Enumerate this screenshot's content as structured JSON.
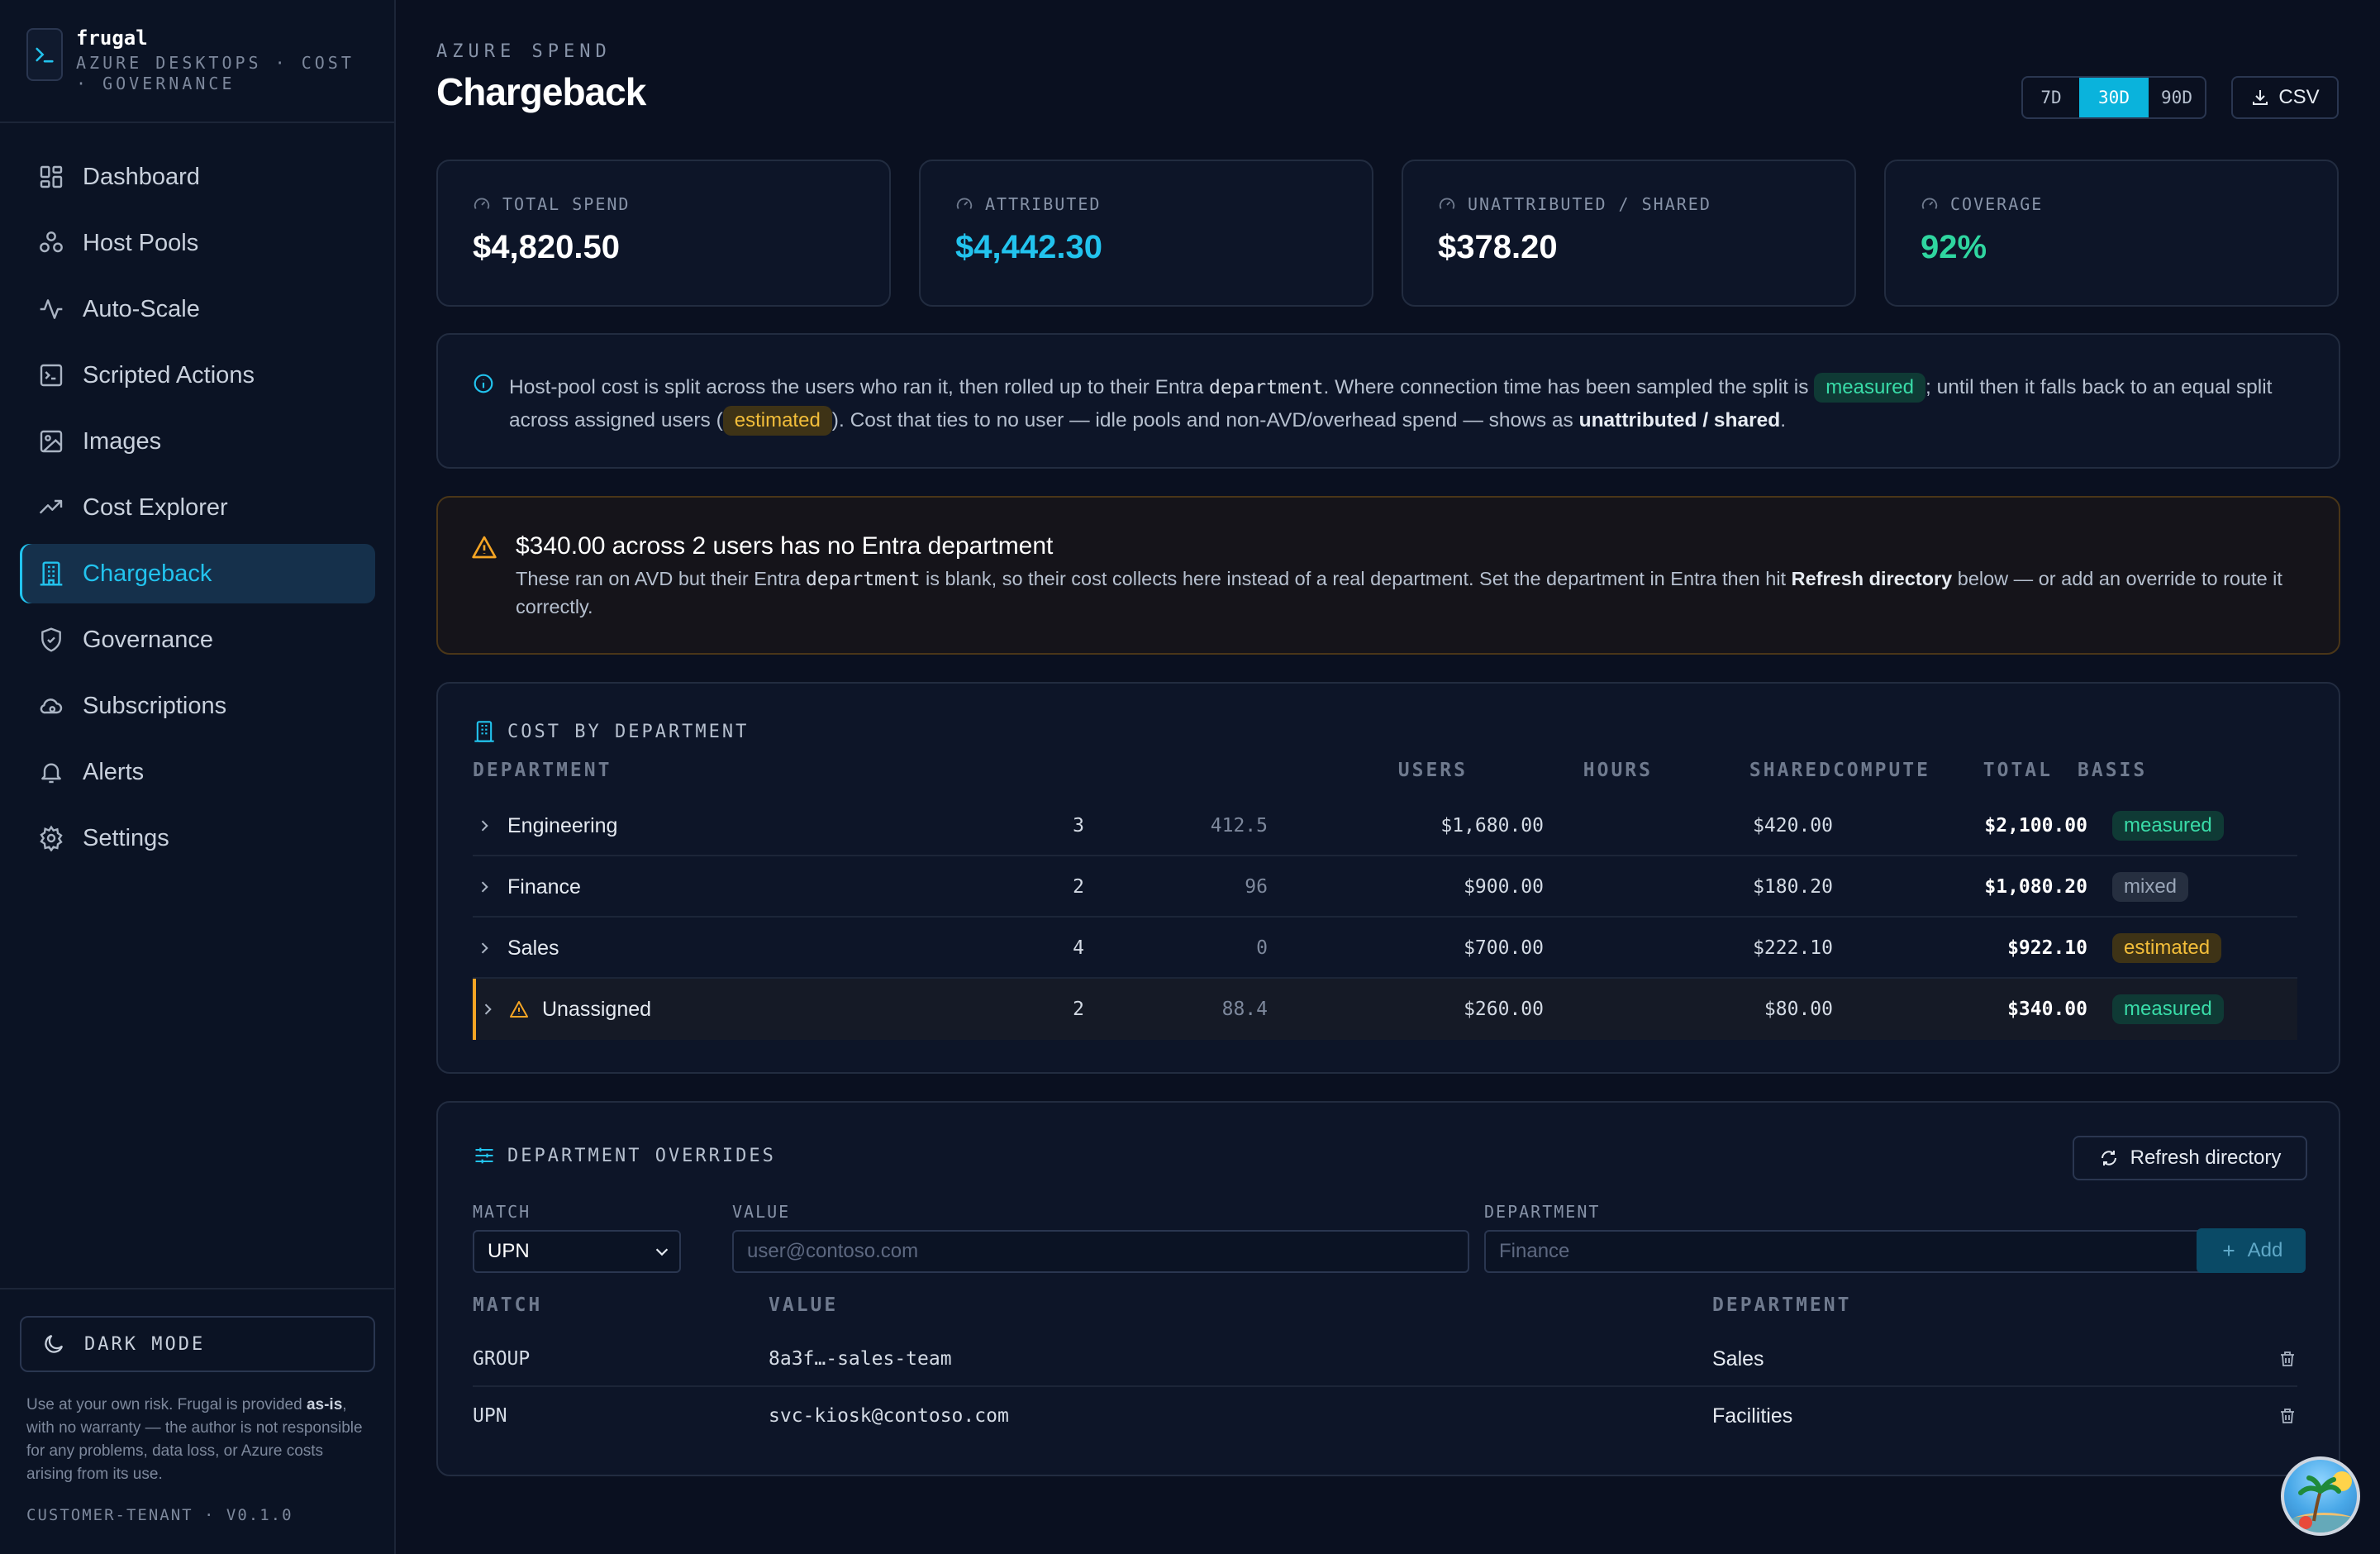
{
  "brand": {
    "name": "frugal",
    "subtitle": "AZURE DESKTOPS · COST · GOVERNANCE"
  },
  "nav": [
    {
      "label": "Dashboard",
      "icon": "dashboard-icon"
    },
    {
      "label": "Host Pools",
      "icon": "host-pools-icon"
    },
    {
      "label": "Auto-Scale",
      "icon": "activity-icon"
    },
    {
      "label": "Scripted Actions",
      "icon": "terminal-icon"
    },
    {
      "label": "Images",
      "icon": "image-icon"
    },
    {
      "label": "Cost Explorer",
      "icon": "trend-icon"
    },
    {
      "label": "Chargeback",
      "icon": "receipt-icon",
      "active": true
    },
    {
      "label": "Governance",
      "icon": "shield-icon"
    },
    {
      "label": "Subscriptions",
      "icon": "cloud-icon"
    },
    {
      "label": "Alerts",
      "icon": "bell-icon"
    },
    {
      "label": "Settings",
      "icon": "gear-icon"
    }
  ],
  "sidebar_footer": {
    "dark_mode_label": "DARK MODE",
    "disclaimer_pre": "Use at your own risk. Frugal is provided ",
    "disclaimer_bold": "as-is",
    "disclaimer_post": ", with no warranty — the author is not responsible for any problems, data loss, or Azure costs arising from its use.",
    "tenant_version": "CUSTOMER-TENANT · V0.1.0"
  },
  "header": {
    "eyebrow": "AZURE SPEND",
    "title": "Chargeback",
    "ranges": [
      "7D",
      "30D",
      "90D"
    ],
    "selected_range": "30D",
    "csv_label": "CSV"
  },
  "stats": [
    {
      "label": "TOTAL SPEND",
      "value": "$4,820.50",
      "tone": "white"
    },
    {
      "label": "ATTRIBUTED",
      "value": "$4,442.30",
      "tone": "cyan"
    },
    {
      "label": "UNATTRIBUTED / SHARED",
      "value": "$378.20",
      "tone": "white"
    },
    {
      "label": "COVERAGE",
      "value": "92%",
      "tone": "green"
    }
  ],
  "info": {
    "t1": "Host-pool cost is split across the users who ran it, then rolled up to their Entra ",
    "code": "department",
    "t2": ". Where connection time has been sampled the split is ",
    "pill_measured": "measured",
    "t3": "; until then it falls back to an equal split across assigned users (",
    "pill_estimated": "estimated",
    "t4": "). Cost that ties to no user — idle pools and non-AVD/overhead spend — shows as ",
    "bold": "unattributed / shared",
    "t5": "."
  },
  "warning": {
    "title": "$340.00 across 2 users has no Entra department",
    "b1": "These ran on AVD but their Entra ",
    "code": "department",
    "b2": " is blank, so their cost collects here instead of a real department. Set the department in Entra then hit ",
    "bold": "Refresh directory",
    "b3": " below — or add an override to route it correctly."
  },
  "departments": {
    "title": "COST BY DEPARTMENT",
    "columns": [
      "DEPARTMENT",
      "USERS",
      "HOURS",
      "COMPUTE",
      "SHARED",
      "TOTAL",
      "BASIS"
    ],
    "rows": [
      {
        "name": "Engineering",
        "users": "3",
        "hours": "412.5",
        "compute": "$1,680.00",
        "shared": "$420.00",
        "total": "$2,100.00",
        "basis": "measured"
      },
      {
        "name": "Finance",
        "users": "2",
        "hours": "96",
        "compute": "$900.00",
        "shared": "$180.20",
        "total": "$1,080.20",
        "basis": "mixed"
      },
      {
        "name": "Sales",
        "users": "4",
        "hours": "0",
        "compute": "$700.00",
        "shared": "$222.10",
        "total": "$922.10",
        "basis": "estimated"
      },
      {
        "name": "Unassigned",
        "users": "2",
        "hours": "88.4",
        "compute": "$260.00",
        "shared": "$80.00",
        "total": "$340.00",
        "basis": "measured",
        "warning": true
      }
    ]
  },
  "overrides": {
    "title": "DEPARTMENT OVERRIDES",
    "refresh_label": "Refresh directory",
    "form": {
      "match_label": "MATCH",
      "match_value": "UPN",
      "value_label": "VALUE",
      "value_placeholder": "user@contoso.com",
      "dept_label": "DEPARTMENT",
      "dept_placeholder": "Finance",
      "add_label": "Add"
    },
    "columns": [
      "MATCH",
      "VALUE",
      "DEPARTMENT"
    ],
    "rows": [
      {
        "match": "GROUP",
        "value": "8a3f…-sales-team",
        "department": "Sales"
      },
      {
        "match": "UPN",
        "value": "svc-kiosk@contoso.com",
        "department": "Facilities"
      }
    ]
  },
  "colors": {
    "accent": "#22c3ee",
    "measured": "#39dca8",
    "estimated": "#f3be3a",
    "warning": "#f5a524",
    "background": "#0a1020"
  }
}
